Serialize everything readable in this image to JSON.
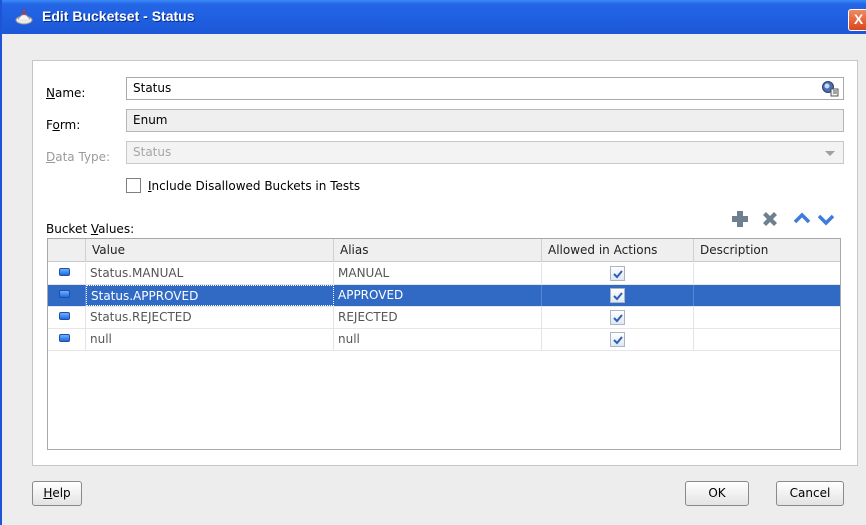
{
  "window": {
    "title": "Edit Bucketset - Status",
    "close_glyph": "X"
  },
  "form": {
    "name_label": {
      "pre": "",
      "key": "N",
      "post": "ame:"
    },
    "name_value": "Status",
    "form_label": {
      "pre": "F",
      "key": "o",
      "post": "rm:"
    },
    "form_value": "Enum",
    "datatype_label": {
      "pre": "",
      "key": "D",
      "post": "ata Type:"
    },
    "datatype_value": "Status",
    "include_label": {
      "pre": "",
      "key": "I",
      "post": "nclude Disallowed Buckets in Tests"
    },
    "include_checked": false
  },
  "bucket_values": {
    "label": {
      "pre": "Bucket ",
      "key": "V",
      "post": "alues:"
    },
    "toolbar": [
      "add-icon",
      "delete-icon",
      "move-up-icon",
      "move-down-icon"
    ],
    "columns": [
      "",
      "Value",
      "Alias",
      "Allowed in Actions",
      "Description"
    ],
    "rows": [
      {
        "value": "Status.MANUAL",
        "alias": "MANUAL",
        "allowed": true,
        "description": "",
        "selected": false
      },
      {
        "value": "Status.APPROVED",
        "alias": "APPROVED",
        "allowed": true,
        "description": "",
        "selected": true
      },
      {
        "value": "Status.REJECTED",
        "alias": "REJECTED",
        "allowed": true,
        "description": "",
        "selected": false
      },
      {
        "value": "null",
        "alias": "null",
        "allowed": true,
        "description": "",
        "selected": false
      }
    ]
  },
  "buttons": {
    "help": {
      "pre": "",
      "key": "H",
      "post": "elp"
    },
    "ok": "OK",
    "cancel": "Cancel"
  },
  "colors": {
    "titlebar": "#1f5fe0",
    "selection": "#316ac5",
    "close": "#d9461c"
  }
}
